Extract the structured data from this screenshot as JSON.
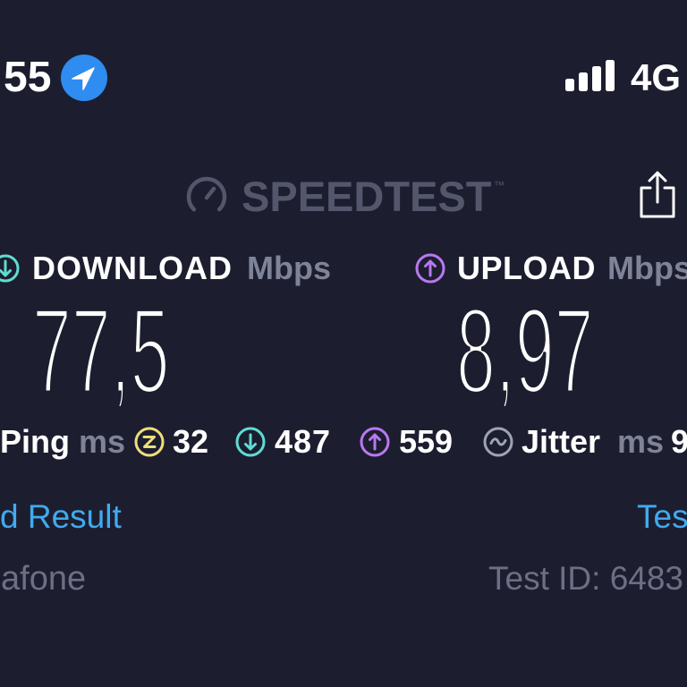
{
  "status_bar": {
    "time": "55",
    "network": "4G",
    "signal_strength": 4,
    "location_icon": "location-arrow-icon",
    "signal_icon": "signal-bars-icon"
  },
  "header": {
    "logo_icon": "speedtest-gauge-icon",
    "logo_text": "SPEEDTEST",
    "trademark": "™",
    "share_icon": "share-icon"
  },
  "download": {
    "icon": "download-arrow-icon",
    "label": "DOWNLOAD",
    "unit": "Mbps",
    "value": "77,5"
  },
  "upload": {
    "icon": "upload-arrow-icon",
    "label": "UPLOAD",
    "unit": "Mbps",
    "value": "8,97"
  },
  "ping": {
    "label": "Ping",
    "unit": "ms",
    "idle_icon": "ping-idle-icon",
    "idle": "32",
    "download_icon": "ping-download-icon",
    "download": "487",
    "upload_icon": "ping-upload-icon",
    "upload": "559"
  },
  "jitter": {
    "icon": "jitter-wave-icon",
    "label": "Jitter",
    "unit": "ms",
    "value": "9"
  },
  "links": {
    "result": "d Result",
    "test": "Tes"
  },
  "footer": {
    "provider": "afone",
    "test_id": "Test ID: 6483"
  },
  "colors": {
    "background": "#1c1e2f",
    "text": "#ffffff",
    "muted": "#7f8398",
    "logo": "#54576b",
    "download": "#5fdcd3",
    "upload": "#b978f0",
    "ping": "#efde7b",
    "jitter": "#9fa3b6",
    "link": "#41aaf0",
    "footer": "#6d7084",
    "location": "#2f8cf0"
  }
}
